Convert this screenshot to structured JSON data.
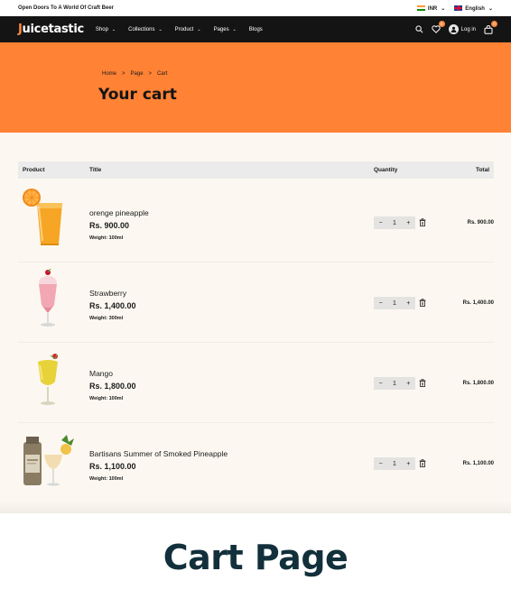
{
  "topbar": {
    "promo": "Open Doors To A World Of Craft Beer",
    "currency": "INR",
    "language": "English"
  },
  "navbar": {
    "logo": "Juicetastic",
    "items": [
      {
        "label": "Shop"
      },
      {
        "label": "Collections"
      },
      {
        "label": "Product"
      },
      {
        "label": "Pages"
      },
      {
        "label": "Blogs"
      }
    ],
    "wishlist_count": "0",
    "login": "Log in",
    "cart_count": "0"
  },
  "hero": {
    "breadcrumb": [
      "Home",
      ">",
      "Page",
      ">",
      "Cart"
    ],
    "title": "Your cart"
  },
  "cart": {
    "headers": {
      "product": "Product",
      "title": "Title",
      "quantity": "Quantity",
      "total": "Total"
    },
    "items": [
      {
        "title": "orenge pineapple",
        "price": "Rs. 900.00",
        "weight": "Weight: 100ml",
        "qty": "1",
        "total": "Rs. 900.00",
        "image": "orange-juice-glass"
      },
      {
        "title": "Strawberry",
        "price": "Rs. 1,400.00",
        "weight": "Weight: 300ml",
        "qty": "1",
        "total": "Rs. 1,400.00",
        "image": "strawberry-milkshake"
      },
      {
        "title": "Mango",
        "price": "Rs. 1,800.00",
        "weight": "Weight: 100ml",
        "qty": "1",
        "total": "Rs. 1,800.00",
        "image": "mango-cocktail"
      },
      {
        "title": "Bartisans Summer of Smoked Pineapple",
        "price": "Rs. 1,100.00",
        "weight": "Weight: 100ml",
        "qty": "1",
        "total": "Rs. 1,100.00",
        "image": "pineapple-bottle-cocktail"
      }
    ]
  },
  "footer": {
    "title": "Cart Page"
  },
  "colors": {
    "accent": "#ff8235",
    "dark": "#141414",
    "cart_bg": "#fcf8f1",
    "footer_text": "#12303b"
  }
}
